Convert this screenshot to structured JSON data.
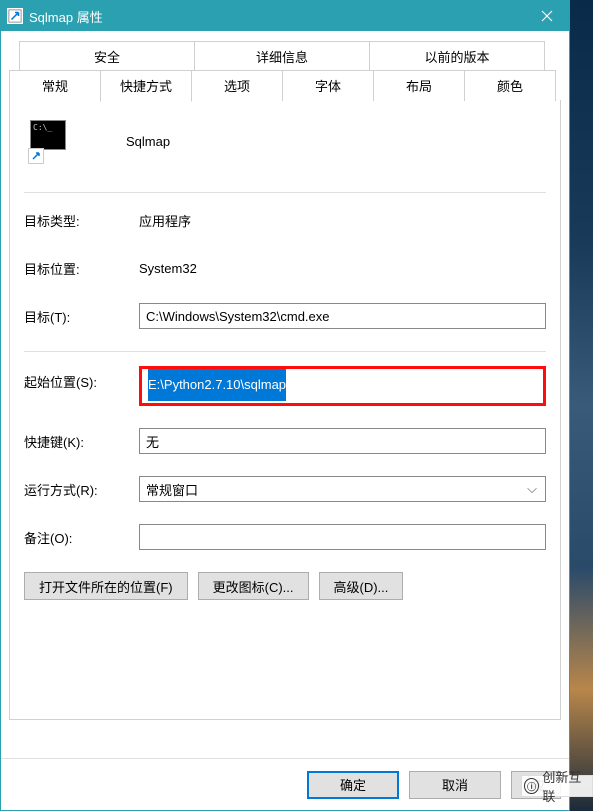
{
  "window": {
    "title": "Sqlmap 属性"
  },
  "tabs": {
    "top": [
      "安全",
      "详细信息",
      "以前的版本"
    ],
    "bottom": [
      "常规",
      "快捷方式",
      "选项",
      "字体",
      "布局",
      "颜色"
    ],
    "active": "快捷方式"
  },
  "app": {
    "name": "Sqlmap"
  },
  "fields": {
    "target_type": {
      "label": "目标类型:",
      "value": "应用程序"
    },
    "target_location": {
      "label": "目标位置:",
      "value": "System32"
    },
    "target": {
      "label": "目标(T):",
      "value": "C:\\Windows\\System32\\cmd.exe"
    },
    "start_in": {
      "label": "起始位置(S):",
      "value": "E:\\Python2.7.10\\sqlmap"
    },
    "shortcut_key": {
      "label": "快捷键(K):",
      "value": "无"
    },
    "run": {
      "label": "运行方式(R):",
      "value": "常规窗口"
    },
    "comment": {
      "label": "备注(O):",
      "value": ""
    }
  },
  "buttons": {
    "open_location": "打开文件所在的位置(F)",
    "change_icon": "更改图标(C)...",
    "advanced": "高级(D)..."
  },
  "footer": {
    "ok": "确定",
    "cancel": "取消",
    "apply": "应"
  },
  "watermark": "创新互联"
}
